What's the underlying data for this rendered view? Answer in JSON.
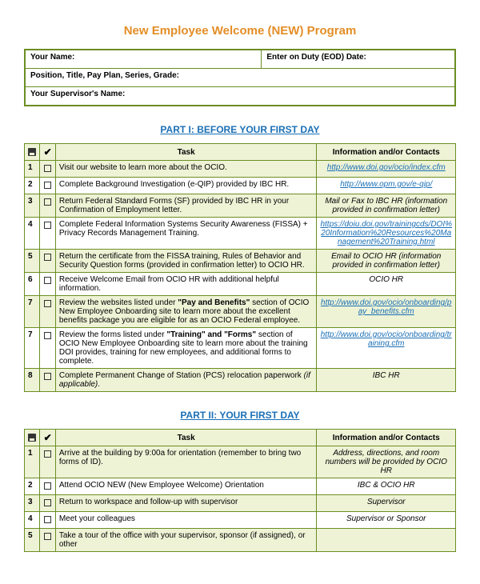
{
  "doc_title": "New Employee Welcome (NEW) Program",
  "header": {
    "your_name_label": "Your Name:",
    "eod_label": "Enter on Duty (EOD) Date:",
    "position_label": "Position, Title, Pay Plan, Series, Grade:",
    "supervisor_label": "Your Supervisor's Name:"
  },
  "part1": {
    "heading": "PART I:  BEFORE YOUR FIRST DAY",
    "cols": {
      "task": "Task",
      "info": "Information and/or Contacts"
    },
    "rows": [
      {
        "n": "1",
        "shaded": true,
        "task_html": "Visit our website to learn more about the OCIO.",
        "info_link": "http://www.doi.gov/ocio/index.cfm"
      },
      {
        "n": "2",
        "shaded": false,
        "task_html": "Complete Background Investigation (e-QIP) provided by IBC HR.",
        "info_link": "http://www.opm.gov/e-qip/"
      },
      {
        "n": "3",
        "shaded": true,
        "task_html": "Return Federal Standard Forms (SF) provided by IBC HR in your Confirmation of Employment letter.",
        "info_text": "Mail or Fax to IBC HR (information provided in confirmation letter)"
      },
      {
        "n": "4",
        "shaded": false,
        "task_html": "Complete Federal Information Systems Security Awareness (FISSA) + Privacy Records Management Training.",
        "info_link": "https://doiu.doi.gov/trainingcds/DOI%20Information%20Resources%20Management%20Training.html"
      },
      {
        "n": "5",
        "shaded": true,
        "task_html": "Return the certificate from the FISSA training, Rules of Behavior and Security Question forms (provided in confirmation letter) to OCIO HR.",
        "info_text": "Email to OCIO HR (information provided in confirmation letter)"
      },
      {
        "n": "6",
        "shaded": false,
        "task_html": "Receive Welcome Email from OCIO HR with additional helpful information.",
        "info_text": "OCIO HR"
      },
      {
        "n": "7",
        "shaded": true,
        "task_html": "Review the websites listed under <b>\"Pay and Benefits\"</b> section of OCIO New Employee Onboarding site to learn more about the excellent benefits package you are eligible for as an OCIO Federal employee.",
        "info_link": "http://www.doi.gov/ocio/onboarding/pay_benefits.cfm"
      },
      {
        "n": "7",
        "shaded": false,
        "task_html": "Review the forms listed under <b>\"Training\" and \"Forms\"</b> section of OCIO New Employee Onboarding site to learn more about the training DOI provides, training for new employees, and additional forms to complete.",
        "info_link": "http://www.doi.gov/ocio/onboarding/training.cfm"
      },
      {
        "n": "8",
        "shaded": true,
        "task_html": "Complete Permanent Change of Station (PCS) relocation paperwork <i>(if applicable)</i>.",
        "info_text": "IBC HR"
      }
    ]
  },
  "part2": {
    "heading": "PART II:  YOUR FIRST DAY",
    "cols": {
      "task": "Task",
      "info": "Information and/or Contacts"
    },
    "rows": [
      {
        "n": "1",
        "shaded": true,
        "task_html": "Arrive at the building by 9:00a for orientation (remember to bring two forms of ID).",
        "info_text": "Address, directions, and room numbers will be provided by OCIO HR"
      },
      {
        "n": "2",
        "shaded": false,
        "task_html": "Attend OCIO NEW (New Employee Welcome) Orientation",
        "info_text": "IBC & OCIO HR"
      },
      {
        "n": "3",
        "shaded": true,
        "task_html": "Return to workspace and follow-up with supervisor",
        "info_text": "Supervisor"
      },
      {
        "n": "4",
        "shaded": false,
        "task_html": "Meet your colleagues",
        "info_text": "Supervisor or Sponsor"
      },
      {
        "n": "5",
        "shaded": true,
        "task_html": "Take a tour of the office with your supervisor, sponsor (if assigned), or other",
        "info_text": ""
      }
    ]
  }
}
